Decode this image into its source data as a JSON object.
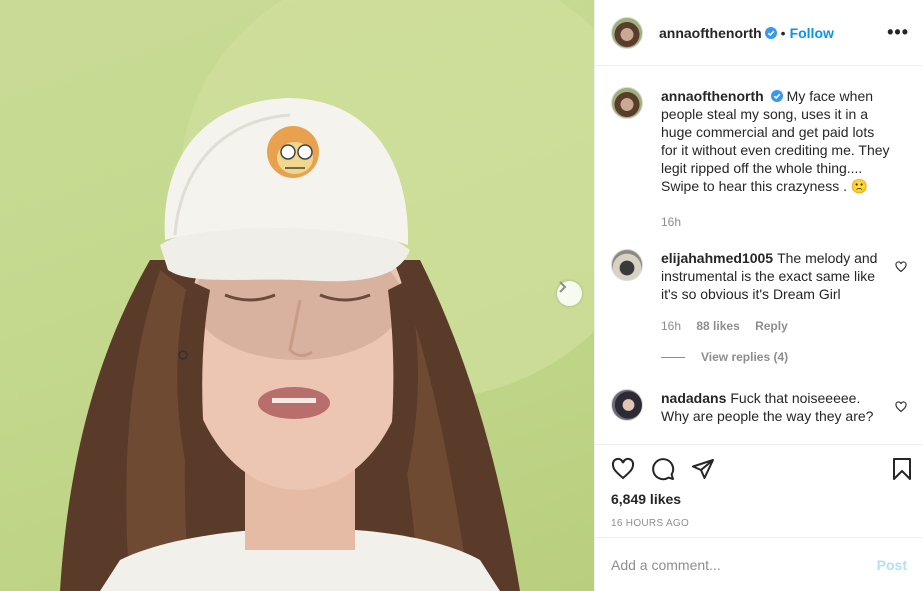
{
  "colors": {
    "accent": "#0095f6",
    "text": "#262626",
    "muted": "#8e8e8e",
    "post_disabled": "#b2dffc"
  },
  "media": {
    "next_icon": "chevron-right-icon",
    "alt": "photo"
  },
  "header": {
    "username": "annaofthenorth",
    "separator": "•",
    "follow": "Follow",
    "more": "•••"
  },
  "caption": {
    "username": "annaofthenorth",
    "text": "My face when people steal my song, uses it in a huge commercial and get paid lots for it without even crediting me. They legit ripped off the whole thing.... Swipe to hear this crazyness . ",
    "emoji": "🙁",
    "time": "16h"
  },
  "comments": [
    {
      "username": "elijahahmed1005",
      "text": "The melody and instrumental is the exact same like it's so obvious it's Dream Girl",
      "time": "16h",
      "likes": "88 likes",
      "reply": "Reply",
      "view_replies": "View replies (4)"
    },
    {
      "username": "nadadans",
      "text": "Fuck that noiseeeee. Why are people the way they are?"
    }
  ],
  "actions": {
    "like_icon": "heart-icon",
    "comment_icon": "comment-icon",
    "share_icon": "share-icon",
    "save_icon": "bookmark-icon"
  },
  "likes": "6,849 likes",
  "timestamp": "16 hours ago",
  "add_comment": {
    "placeholder": "Add a comment...",
    "post": "Post"
  }
}
